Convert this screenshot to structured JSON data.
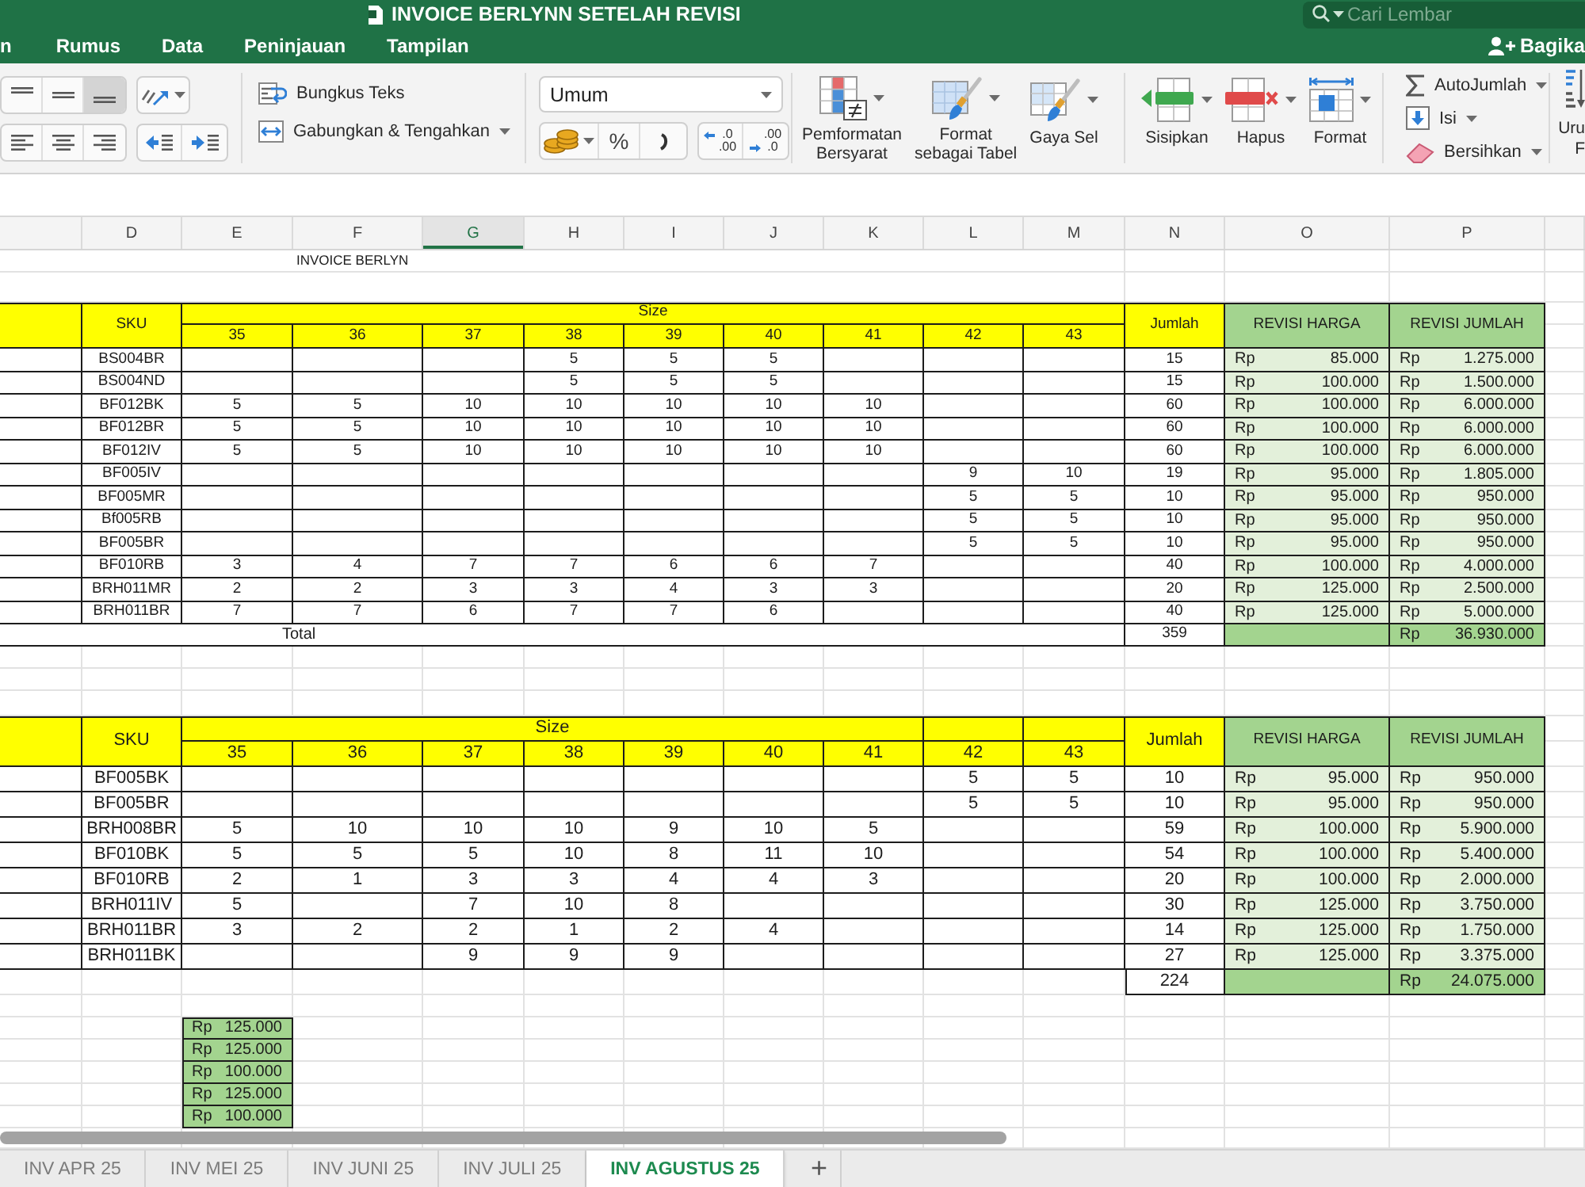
{
  "window": {
    "title": "INVOICE BERLYNN SETELAH REVISI",
    "search_placeholder": "Cari Lembar",
    "share_label": "Bagika"
  },
  "menu_tabs": [
    {
      "label": "n",
      "selected": false
    },
    {
      "label": "Rumus",
      "selected": false
    },
    {
      "label": "Data",
      "selected": false
    },
    {
      "label": "Peninjauan",
      "selected": false
    },
    {
      "label": "Tampilan",
      "selected": false
    }
  ],
  "ribbon": {
    "vertical_align": [
      {
        "kind": "top",
        "selected": false
      },
      {
        "kind": "middle",
        "selected": false
      },
      {
        "kind": "bottom",
        "selected": true
      }
    ],
    "horizontal_align": [
      {
        "kind": "left",
        "selected": false
      },
      {
        "kind": "center",
        "selected": false
      },
      {
        "kind": "right",
        "selected": false
      }
    ],
    "wrap_text": "Bungkus Teks",
    "merge_center": "Gabungkan & Tengahkan",
    "number_format": "Umum",
    "percent": "%",
    "decimal_buttons": [
      {
        "kind": "increase",
        "top": ".0",
        "bottom": ".00"
      },
      {
        "kind": "decrease",
        "top": ".00",
        "bottom": ".0"
      }
    ],
    "style_buttons": [
      {
        "kind": "conditional",
        "lines": [
          "Pemformatan",
          "Bersyarat"
        ]
      },
      {
        "kind": "table",
        "lines": [
          "Format",
          "sebagai Tabel"
        ]
      },
      {
        "kind": "cell_style",
        "lines": [
          "Gaya Sel"
        ]
      }
    ],
    "cell_buttons": [
      {
        "kind": "insert",
        "label": "Sisipkan"
      },
      {
        "kind": "delete",
        "label": "Hapus"
      },
      {
        "kind": "format",
        "label": "Format"
      }
    ],
    "edit_buttons": [
      {
        "kind": "sum",
        "label": "AutoJumlah"
      },
      {
        "kind": "fill",
        "label": "Isi"
      },
      {
        "kind": "clear",
        "label": "Bersihkan"
      }
    ],
    "sort_lines": [
      "Uru",
      "F"
    ]
  },
  "sheet": {
    "column_headers": [
      {
        "label": "D",
        "selected": false
      },
      {
        "label": "E",
        "selected": false
      },
      {
        "label": "F",
        "selected": false
      },
      {
        "label": "G",
        "selected": true
      },
      {
        "label": "H",
        "selected": false
      },
      {
        "label": "I",
        "selected": false
      },
      {
        "label": "J",
        "selected": false
      },
      {
        "label": "K",
        "selected": false
      },
      {
        "label": "L",
        "selected": false
      },
      {
        "label": "M",
        "selected": false
      },
      {
        "label": "N",
        "selected": false
      },
      {
        "label": "O",
        "selected": false
      },
      {
        "label": "P",
        "selected": false
      }
    ],
    "title": "INVOICE BERLYN",
    "tables": [
      {
        "sku_header": "SKU",
        "size_header": "Size",
        "grouped_sizes": [
          "35",
          "36",
          "37",
          "38",
          "39",
          "40",
          "41",
          "42",
          "43"
        ],
        "quantity_header": "Jumlah",
        "price_header": "REVISI HARGA",
        "amount_header": "REVISI JUMLAH",
        "rows": [
          {
            "sku": "BS004BR",
            "cells": [
              {
                "kind": "empty"
              },
              {
                "kind": "empty"
              },
              {
                "kind": "empty"
              },
              {
                "kind": "qty",
                "value": "5"
              },
              {
                "kind": "qty",
                "value": "5"
              },
              {
                "kind": "qty",
                "value": "5"
              },
              {
                "kind": "empty"
              },
              {
                "kind": "empty"
              },
              {
                "kind": "empty"
              }
            ],
            "total": "15",
            "price_currency": "Rp",
            "price": "85.000",
            "amount_currency": "Rp",
            "amount": "1.275.000"
          },
          {
            "sku": "BS004ND",
            "cells": [
              {
                "kind": "empty"
              },
              {
                "kind": "empty"
              },
              {
                "kind": "empty"
              },
              {
                "kind": "qty",
                "value": "5"
              },
              {
                "kind": "qty",
                "value": "5"
              },
              {
                "kind": "qty",
                "value": "5"
              },
              {
                "kind": "empty"
              },
              {
                "kind": "empty"
              },
              {
                "kind": "empty"
              }
            ],
            "total": "15",
            "price_currency": "Rp",
            "price": "100.000",
            "amount_currency": "Rp",
            "amount": "1.500.000"
          },
          {
            "sku": "BF012BK",
            "cells": [
              {
                "kind": "qty",
                "value": "5"
              },
              {
                "kind": "qty",
                "value": "5"
              },
              {
                "kind": "qty",
                "value": "10"
              },
              {
                "kind": "qty",
                "value": "10"
              },
              {
                "kind": "qty",
                "value": "10"
              },
              {
                "kind": "qty",
                "value": "10"
              },
              {
                "kind": "qty",
                "value": "10"
              },
              {
                "kind": "empty"
              },
              {
                "kind": "empty"
              }
            ],
            "total": "60",
            "price_currency": "Rp",
            "price": "100.000",
            "amount_currency": "Rp",
            "amount": "6.000.000"
          },
          {
            "sku": "BF012BR",
            "cells": [
              {
                "kind": "qty",
                "value": "5"
              },
              {
                "kind": "qty",
                "value": "5"
              },
              {
                "kind": "qty",
                "value": "10"
              },
              {
                "kind": "qty",
                "value": "10"
              },
              {
                "kind": "qty",
                "value": "10"
              },
              {
                "kind": "qty",
                "value": "10"
              },
              {
                "kind": "qty",
                "value": "10"
              },
              {
                "kind": "empty"
              },
              {
                "kind": "empty"
              }
            ],
            "total": "60",
            "price_currency": "Rp",
            "price": "100.000",
            "amount_currency": "Rp",
            "amount": "6.000.000"
          },
          {
            "sku": "BF012IV",
            "cells": [
              {
                "kind": "qty",
                "value": "5"
              },
              {
                "kind": "qty",
                "value": "5"
              },
              {
                "kind": "qty",
                "value": "10"
              },
              {
                "kind": "qty",
                "value": "10"
              },
              {
                "kind": "qty",
                "value": "10"
              },
              {
                "kind": "qty",
                "value": "10"
              },
              {
                "kind": "qty",
                "value": "10"
              },
              {
                "kind": "empty"
              },
              {
                "kind": "empty"
              }
            ],
            "total": "60",
            "price_currency": "Rp",
            "price": "100.000",
            "amount_currency": "Rp",
            "amount": "6.000.000"
          },
          {
            "sku": "BF005IV",
            "cells": [
              {
                "kind": "empty"
              },
              {
                "kind": "empty"
              },
              {
                "kind": "empty"
              },
              {
                "kind": "empty"
              },
              {
                "kind": "empty"
              },
              {
                "kind": "empty"
              },
              {
                "kind": "empty"
              },
              {
                "kind": "qty",
                "value": "9"
              },
              {
                "kind": "qty",
                "value": "10"
              }
            ],
            "total": "19",
            "price_currency": "Rp",
            "price": "95.000",
            "amount_currency": "Rp",
            "amount": "1.805.000"
          },
          {
            "sku": "BF005MR",
            "cells": [
              {
                "kind": "empty"
              },
              {
                "kind": "empty"
              },
              {
                "kind": "empty"
              },
              {
                "kind": "empty"
              },
              {
                "kind": "empty"
              },
              {
                "kind": "empty"
              },
              {
                "kind": "empty"
              },
              {
                "kind": "qty",
                "value": "5"
              },
              {
                "kind": "qty",
                "value": "5"
              }
            ],
            "total": "10",
            "price_currency": "Rp",
            "price": "95.000",
            "amount_currency": "Rp",
            "amount": "950.000"
          },
          {
            "sku": "Bf005RB",
            "cells": [
              {
                "kind": "empty"
              },
              {
                "kind": "empty"
              },
              {
                "kind": "empty"
              },
              {
                "kind": "empty"
              },
              {
                "kind": "empty"
              },
              {
                "kind": "empty"
              },
              {
                "kind": "empty"
              },
              {
                "kind": "qty",
                "value": "5"
              },
              {
                "kind": "qty",
                "value": "5"
              }
            ],
            "total": "10",
            "price_currency": "Rp",
            "price": "95.000",
            "amount_currency": "Rp",
            "amount": "950.000"
          },
          {
            "sku": "BF005BR",
            "cells": [
              {
                "kind": "empty"
              },
              {
                "kind": "empty"
              },
              {
                "kind": "empty"
              },
              {
                "kind": "empty"
              },
              {
                "kind": "empty"
              },
              {
                "kind": "empty"
              },
              {
                "kind": "empty"
              },
              {
                "kind": "qty",
                "value": "5"
              },
              {
                "kind": "qty",
                "value": "5"
              }
            ],
            "total": "10",
            "price_currency": "Rp",
            "price": "95.000",
            "amount_currency": "Rp",
            "amount": "950.000"
          },
          {
            "sku": "BF010RB",
            "cells": [
              {
                "kind": "qty",
                "value": "3"
              },
              {
                "kind": "qty",
                "value": "4"
              },
              {
                "kind": "qty",
                "value": "7"
              },
              {
                "kind": "qty",
                "value": "7"
              },
              {
                "kind": "qty",
                "value": "6"
              },
              {
                "kind": "qty",
                "value": "6"
              },
              {
                "kind": "qty",
                "value": "7"
              },
              {
                "kind": "empty"
              },
              {
                "kind": "empty"
              }
            ],
            "total": "40",
            "price_currency": "Rp",
            "price": "100.000",
            "amount_currency": "Rp",
            "amount": "4.000.000"
          },
          {
            "sku": "BRH011MR",
            "cells": [
              {
                "kind": "qty",
                "value": "2"
              },
              {
                "kind": "qty",
                "value": "2"
              },
              {
                "kind": "qty",
                "value": "3"
              },
              {
                "kind": "qty",
                "value": "3"
              },
              {
                "kind": "qty",
                "value": "4"
              },
              {
                "kind": "qty",
                "value": "3"
              },
              {
                "kind": "qty",
                "value": "3"
              },
              {
                "kind": "empty"
              },
              {
                "kind": "empty"
              }
            ],
            "total": "20",
            "price_currency": "Rp",
            "price": "125.000",
            "amount_currency": "Rp",
            "amount": "2.500.000"
          },
          {
            "sku": "BRH011BR",
            "cells": [
              {
                "kind": "qty",
                "value": "7"
              },
              {
                "kind": "qty",
                "value": "7"
              },
              {
                "kind": "qty",
                "value": "6"
              },
              {
                "kind": "qty",
                "value": "7"
              },
              {
                "kind": "qty",
                "value": "7"
              },
              {
                "kind": "qty",
                "value": "6"
              },
              {
                "kind": "empty"
              },
              {
                "kind": "empty"
              },
              {
                "kind": "empty"
              }
            ],
            "total": "40",
            "price_currency": "Rp",
            "price": "125.000",
            "amount_currency": "Rp",
            "amount": "5.000.000"
          }
        ],
        "total": {
          "label": "Total",
          "quantity": "359",
          "currency": "Rp",
          "amount": "36.930.000"
        }
      },
      {
        "sku_header": "SKU",
        "size_header": "Size",
        "grouped_sizes": [
          "35",
          "36",
          "37",
          "38",
          "39",
          "40",
          "41"
        ],
        "other_sizes": [
          "42",
          "43"
        ],
        "quantity_header": "Jumlah",
        "price_header": "REVISI HARGA",
        "amount_header": "REVISI JUMLAH",
        "rows": [
          {
            "sku": "BF005BK",
            "cells": [
              {
                "kind": "empty"
              },
              {
                "kind": "empty"
              },
              {
                "kind": "empty"
              },
              {
                "kind": "empty"
              },
              {
                "kind": "empty"
              },
              {
                "kind": "empty"
              },
              {
                "kind": "empty"
              },
              {
                "kind": "qty",
                "value": "5"
              },
              {
                "kind": "qty",
                "value": "5"
              }
            ],
            "total": "10",
            "price_currency": "Rp",
            "price": "95.000",
            "amount_currency": "Rp",
            "amount": "950.000"
          },
          {
            "sku": "BF005BR",
            "cells": [
              {
                "kind": "empty"
              },
              {
                "kind": "empty"
              },
              {
                "kind": "empty"
              },
              {
                "kind": "empty"
              },
              {
                "kind": "empty"
              },
              {
                "kind": "empty"
              },
              {
                "kind": "empty"
              },
              {
                "kind": "qty",
                "value": "5"
              },
              {
                "kind": "qty",
                "value": "5"
              }
            ],
            "total": "10",
            "price_currency": "Rp",
            "price": "95.000",
            "amount_currency": "Rp",
            "amount": "950.000"
          },
          {
            "sku": "BRH008BR",
            "cells": [
              {
                "kind": "qty",
                "value": "5"
              },
              {
                "kind": "qty",
                "value": "10"
              },
              {
                "kind": "qty",
                "value": "10"
              },
              {
                "kind": "qty",
                "value": "10"
              },
              {
                "kind": "qty",
                "value": "9"
              },
              {
                "kind": "qty",
                "value": "10"
              },
              {
                "kind": "qty",
                "value": "5"
              },
              {
                "kind": "empty"
              },
              {
                "kind": "empty"
              }
            ],
            "total": "59",
            "price_currency": "Rp",
            "price": "100.000",
            "amount_currency": "Rp",
            "amount": "5.900.000"
          },
          {
            "sku": "BF010BK",
            "cells": [
              {
                "kind": "qty",
                "value": "5"
              },
              {
                "kind": "qty",
                "value": "5"
              },
              {
                "kind": "qty",
                "value": "5"
              },
              {
                "kind": "qty",
                "value": "10"
              },
              {
                "kind": "qty",
                "value": "8"
              },
              {
                "kind": "qty",
                "value": "11"
              },
              {
                "kind": "qty",
                "value": "10"
              },
              {
                "kind": "empty"
              },
              {
                "kind": "empty"
              }
            ],
            "total": "54",
            "price_currency": "Rp",
            "price": "100.000",
            "amount_currency": "Rp",
            "amount": "5.400.000"
          },
          {
            "sku": "BF010RB",
            "cells": [
              {
                "kind": "qty",
                "value": "2"
              },
              {
                "kind": "qty",
                "value": "1"
              },
              {
                "kind": "qty",
                "value": "3"
              },
              {
                "kind": "qty",
                "value": "3"
              },
              {
                "kind": "qty",
                "value": "4"
              },
              {
                "kind": "qty",
                "value": "4"
              },
              {
                "kind": "qty",
                "value": "3"
              },
              {
                "kind": "empty"
              },
              {
                "kind": "empty"
              }
            ],
            "total": "20",
            "price_currency": "Rp",
            "price": "100.000",
            "amount_currency": "Rp",
            "amount": "2.000.000"
          },
          {
            "sku": "BRH011IV",
            "cells": [
              {
                "kind": "qty",
                "value": "5"
              },
              {
                "kind": "empty"
              },
              {
                "kind": "qty",
                "value": "7"
              },
              {
                "kind": "qty",
                "value": "10"
              },
              {
                "kind": "qty",
                "value": "8"
              },
              {
                "kind": "empty"
              },
              {
                "kind": "empty"
              },
              {
                "kind": "empty"
              },
              {
                "kind": "empty"
              }
            ],
            "total": "30",
            "price_currency": "Rp",
            "price": "125.000",
            "amount_currency": "Rp",
            "amount": "3.750.000"
          },
          {
            "sku": "BRH011BR",
            "cells": [
              {
                "kind": "qty",
                "value": "3"
              },
              {
                "kind": "qty",
                "value": "2"
              },
              {
                "kind": "qty",
                "value": "2"
              },
              {
                "kind": "qty",
                "value": "1"
              },
              {
                "kind": "qty",
                "value": "2"
              },
              {
                "kind": "qty",
                "value": "4"
              },
              {
                "kind": "empty"
              },
              {
                "kind": "empty"
              },
              {
                "kind": "empty"
              }
            ],
            "total": "14",
            "price_currency": "Rp",
            "price": "125.000",
            "amount_currency": "Rp",
            "amount": "1.750.000"
          },
          {
            "sku": "BRH011BK",
            "cells": [
              {
                "kind": "empty"
              },
              {
                "kind": "empty"
              },
              {
                "kind": "qty",
                "value": "9"
              },
              {
                "kind": "qty",
                "value": "9"
              },
              {
                "kind": "qty",
                "value": "9"
              },
              {
                "kind": "empty"
              },
              {
                "kind": "empty"
              },
              {
                "kind": "empty"
              },
              {
                "kind": "empty"
              }
            ],
            "total": "27",
            "price_currency": "Rp",
            "price": "125.000",
            "amount_currency": "Rp",
            "amount": "3.375.000"
          }
        ],
        "total": {
          "quantity": "224",
          "currency": "Rp",
          "amount": "24.075.000"
        }
      }
    ],
    "extra_prices": [
      {
        "currency": "Rp",
        "amount": "125.000"
      },
      {
        "currency": "Rp",
        "amount": "125.000"
      },
      {
        "currency": "Rp",
        "amount": "100.000"
      },
      {
        "currency": "Rp",
        "amount": "125.000"
      },
      {
        "currency": "Rp",
        "amount": "100.000"
      }
    ]
  },
  "sheet_tabs": [
    {
      "label": "INV APR 25",
      "selected": false
    },
    {
      "label": "INV MEI 25",
      "selected": false
    },
    {
      "label": "INV JUNI 25",
      "selected": false
    },
    {
      "label": "INV JULI 25",
      "selected": false
    },
    {
      "label": "INV AGUSTUS 25",
      "selected": true
    }
  ],
  "add_sheet": "+"
}
